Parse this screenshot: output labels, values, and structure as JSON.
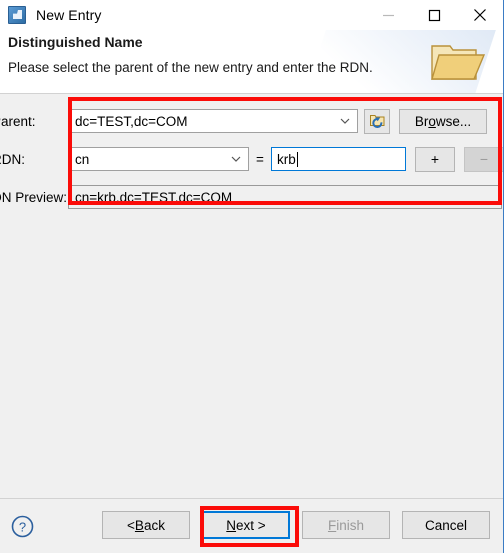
{
  "window": {
    "title": "New Entry",
    "icon": "app-icon",
    "controls": {
      "minimize": "minimize-icon",
      "maximize": "maximize-icon",
      "close": "close-icon"
    }
  },
  "banner": {
    "title": "Distinguished Name",
    "subtitle": "Please select the parent of the new entry and enter the RDN.",
    "icon": "folder-icon"
  },
  "form": {
    "parent": {
      "label": "Parent:",
      "value": "dc=TEST,dc=COM",
      "dropdown_icon": "chevron-down-icon",
      "refresh_button_icon": "folder-refresh-icon",
      "browse_label_pre": "Br",
      "browse_label_mn": "o",
      "browse_label_post": "wse..."
    },
    "rdn": {
      "label": "RDN:",
      "attribute": "cn",
      "dropdown_icon": "chevron-down-icon",
      "equals": "=",
      "value": "krb",
      "add_label": "+",
      "remove_label": "−"
    },
    "preview": {
      "label": "DN Preview:",
      "value": "cn=krb,dc=TEST,dc=COM"
    }
  },
  "footer": {
    "help_icon": "help-icon",
    "buttons": {
      "back_pre": "< ",
      "back_mn": "B",
      "back_post": "ack",
      "next_pre": "",
      "next_mn": "N",
      "next_post": "ext >",
      "finish_mn": "F",
      "finish_post": "inish",
      "cancel": "Cancel"
    }
  },
  "annotations": {
    "accent_color": "#fb0c09",
    "focus_color": "#0078d7",
    "fields_box": "fields-highlight",
    "next_box": "next-button-highlight"
  }
}
